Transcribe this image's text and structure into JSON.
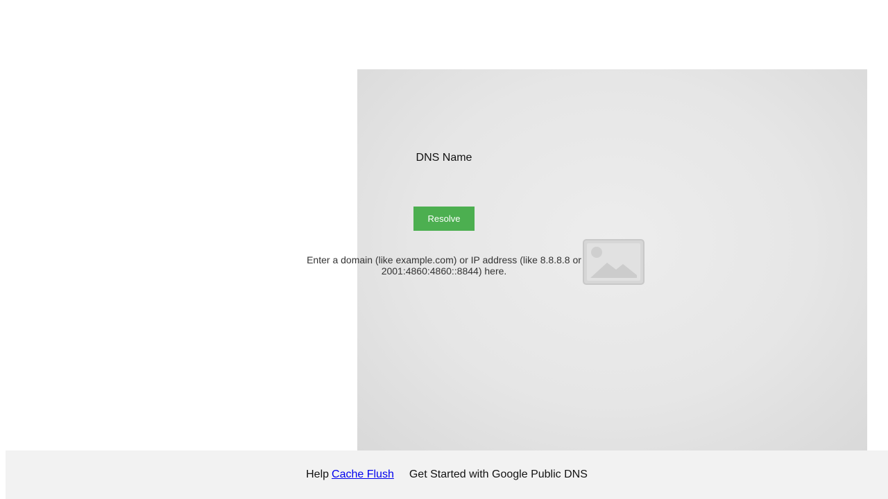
{
  "form": {
    "dns_label": "DNS Name",
    "dns_value": "",
    "resolve_label": "Resolve",
    "help_line1": "Enter a domain (like example.com) or IP address (like 8.8.8.8 or",
    "help_line2": "2001:4860:4860::8844) here."
  },
  "footer": {
    "help_label": "Help",
    "cache_flush_label": "Cache Flush",
    "get_started_label": "Get Started with Google Public DNS"
  },
  "colors": {
    "button": "#4caf50",
    "link": "#0000ee",
    "footer_bg": "#f2f2f2"
  },
  "icons": {
    "broken_image": "image-placeholder-icon"
  }
}
